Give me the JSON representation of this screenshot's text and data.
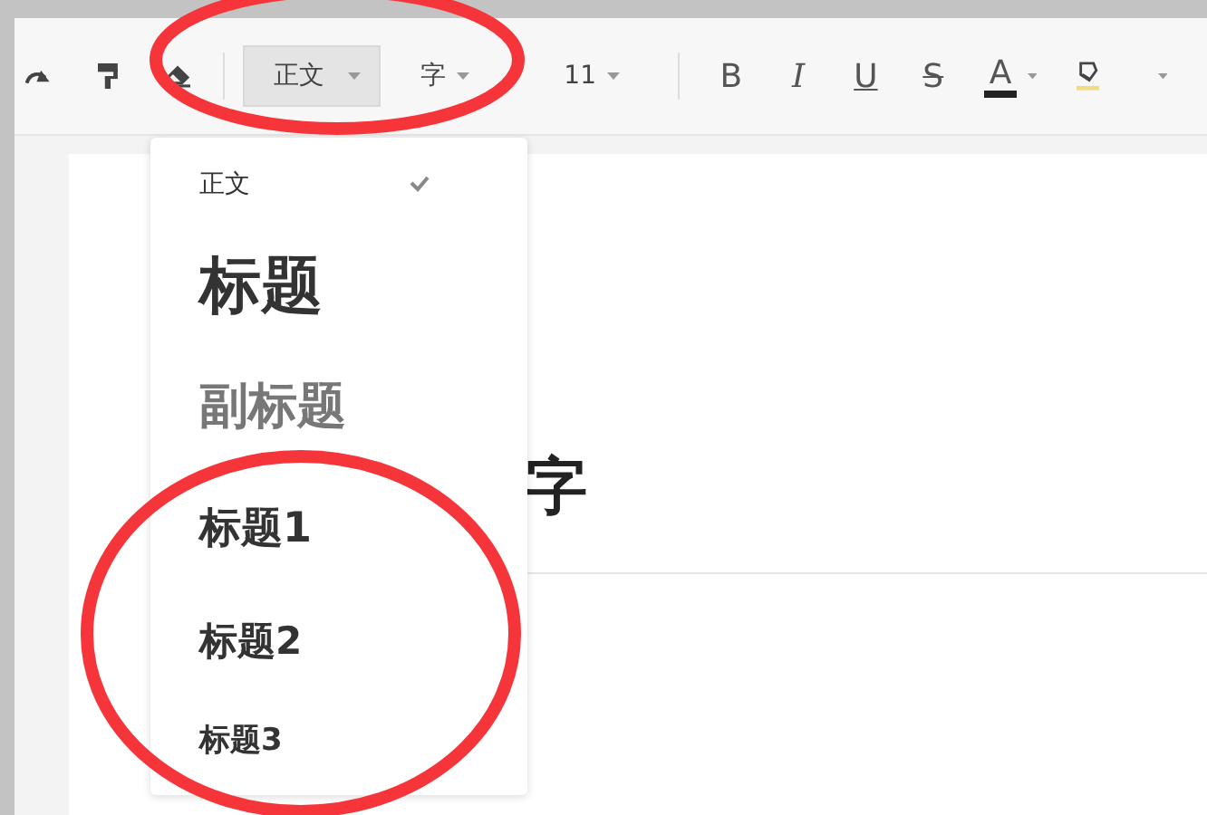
{
  "toolbar": {
    "style_select": {
      "value": "正文"
    },
    "font_select": {
      "value": "字"
    },
    "size_select": {
      "value": "11"
    },
    "format_buttons": [
      {
        "kind": "bold",
        "label": "B"
      },
      {
        "kind": "italic",
        "label": "I"
      },
      {
        "kind": "underline",
        "label": "U"
      },
      {
        "kind": "strike",
        "label": "S"
      },
      {
        "kind": "color",
        "label": "A"
      }
    ]
  },
  "style_menu": {
    "items": [
      {
        "kind": "body",
        "label": "正文",
        "selected": true
      },
      {
        "kind": "title",
        "label": "标题",
        "selected": false
      },
      {
        "kind": "subtitle",
        "label": "副标题",
        "selected": false
      },
      {
        "kind": "h1",
        "label": "标题1",
        "selected": false
      },
      {
        "kind": "h2",
        "label": "标题2",
        "selected": false
      },
      {
        "kind": "h3",
        "label": "标题3",
        "selected": false
      }
    ]
  },
  "document": {
    "heading": "字"
  },
  "annotations": [
    {
      "kind": "ellipse"
    },
    {
      "kind": "ellipse"
    }
  ]
}
